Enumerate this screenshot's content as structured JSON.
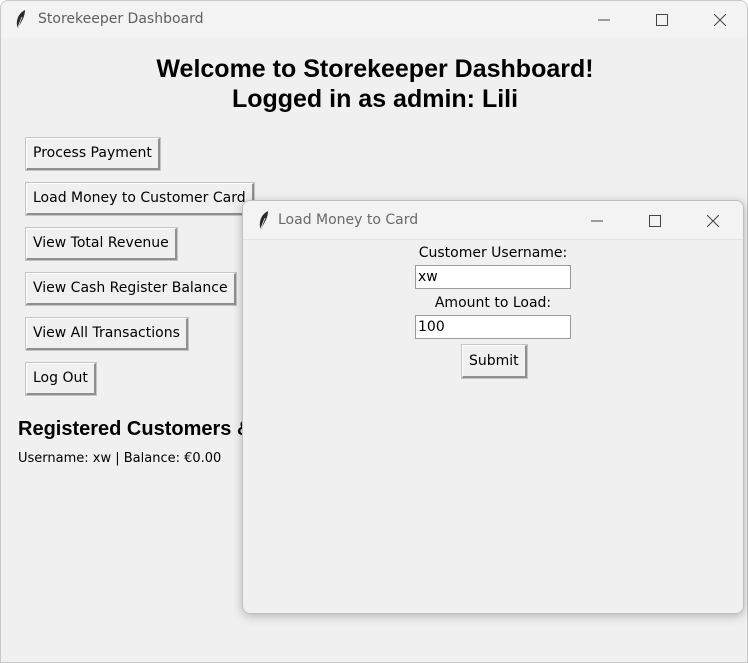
{
  "main_window": {
    "title": "Storekeeper Dashboard",
    "icon": "feather-icon",
    "heading_line1": "Welcome to Storekeeper Dashboard!",
    "heading_line2": "Logged in as admin: Lili",
    "buttons": [
      "Process Payment",
      "Load Money to Customer Card",
      "View Total Revenue",
      "View Cash Register Balance",
      "View All Transactions",
      "Log Out"
    ],
    "section_title": "Registered Customers &",
    "customers": [
      "Username: xw | Balance: €0.00"
    ]
  },
  "dialog": {
    "title": "Load Money to Card",
    "icon": "feather-icon",
    "username_label": "Customer Username:",
    "username_value": "xw",
    "amount_label": "Amount to Load:",
    "amount_value": "100",
    "submit_label": "Submit"
  },
  "colors": {
    "window_bg": "#f0f0f0",
    "titlebar_bg": "#f3f3f3",
    "title_text": "#5f5f5f"
  }
}
